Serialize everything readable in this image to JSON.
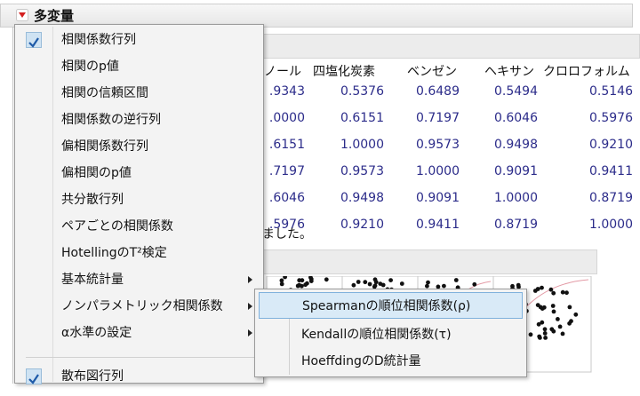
{
  "report": {
    "title": "多変量",
    "note_fragment": "ました。"
  },
  "table": {
    "headers": [
      "ノール",
      "四塩化炭素",
      "ベンゼン",
      "ヘキサン",
      "クロロフォルム"
    ],
    "rows": [
      [
        ".9343",
        "0.5376",
        "0.6489",
        "0.5494",
        "0.5146"
      ],
      [
        ".0000",
        "0.6151",
        "0.7197",
        "0.6046",
        "0.5976"
      ],
      [
        ".6151",
        "1.0000",
        "0.9573",
        "0.9498",
        "0.9210"
      ],
      [
        ".7197",
        "0.9573",
        "1.0000",
        "0.9091",
        "0.9411"
      ],
      [
        ".6046",
        "0.9498",
        "0.9091",
        "1.0000",
        "0.8719"
      ],
      [
        ".5976",
        "0.9210",
        "0.9411",
        "0.8719",
        "1.0000"
      ]
    ]
  },
  "menu": {
    "items": [
      {
        "label": "相関係数行列",
        "checked": true,
        "submenu": false
      },
      {
        "label": "相関のp値",
        "checked": false,
        "submenu": false
      },
      {
        "label": "相関の信頼区間",
        "checked": false,
        "submenu": false
      },
      {
        "label": "相関係数の逆行列",
        "checked": false,
        "submenu": false
      },
      {
        "label": "偏相関係数行列",
        "checked": false,
        "submenu": false
      },
      {
        "label": "偏相関のp値",
        "checked": false,
        "submenu": false
      },
      {
        "label": "共分散行列",
        "checked": false,
        "submenu": false
      },
      {
        "label": "ペアごとの相関係数",
        "checked": false,
        "submenu": false
      },
      {
        "label": "HotellingのT²検定",
        "checked": false,
        "submenu": false
      },
      {
        "label": "基本統計量",
        "checked": false,
        "submenu": true
      },
      {
        "label": "ノンパラメトリック相関係数",
        "checked": false,
        "submenu": true
      },
      {
        "label": "α水準の設定",
        "checked": false,
        "submenu": true
      },
      {
        "label": "散布図行列",
        "checked": true,
        "submenu": false
      }
    ]
  },
  "submenu": {
    "items": [
      {
        "label": "Spearmanの順位相関係数(ρ)",
        "highlighted": true
      },
      {
        "label": "Kendallの順位相関係数(τ)",
        "highlighted": false
      },
      {
        "label": "HoeffdingのD統計量",
        "highlighted": false
      }
    ]
  },
  "colors": {
    "accent_red": "#d42020",
    "value_blue": "#2c2c8a",
    "highlight": "#d9eaf7"
  }
}
